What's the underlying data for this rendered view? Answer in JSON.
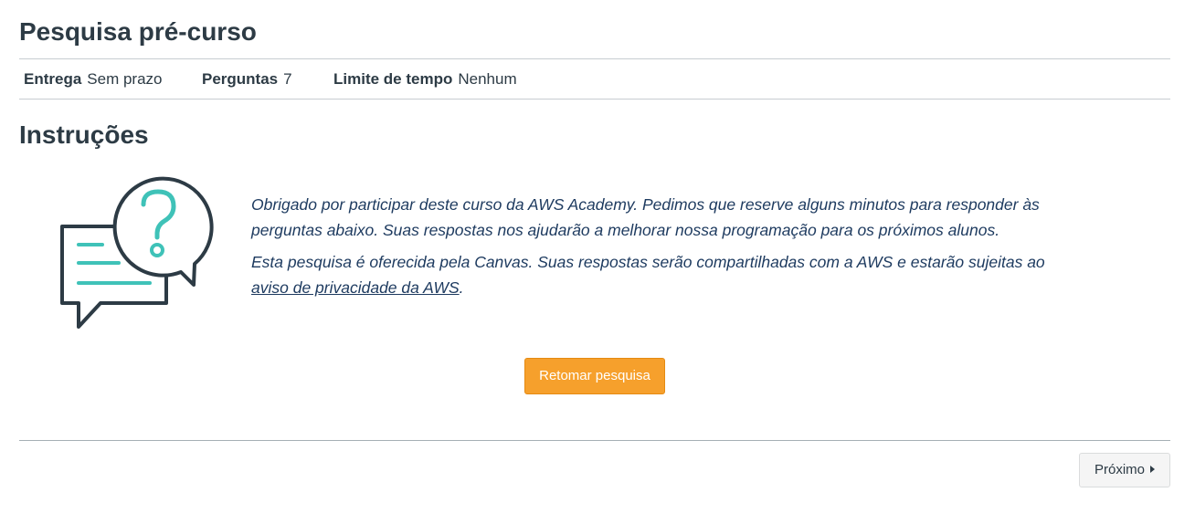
{
  "page": {
    "title": "Pesquisa pré-curso"
  },
  "meta": {
    "due_label": "Entrega",
    "due_value": "Sem prazo",
    "questions_label": "Perguntas",
    "questions_value": "7",
    "time_limit_label": "Limite de tempo",
    "time_limit_value": "Nenhum"
  },
  "instructions": {
    "heading": "Instruções",
    "paragraph1": "Obrigado por participar deste curso da AWS Academy. Pedimos que reserve alguns minutos para responder às perguntas abaixo. Suas respostas nos ajudarão a melhorar nossa programação para os próximos alunos.",
    "paragraph2_prefix": "Esta pesquisa é oferecida pela Canvas. Suas respostas serão compartilhadas com a AWS e estarão sujeitas ao ",
    "privacy_link": "aviso de privacidade da AWS",
    "paragraph2_suffix": "."
  },
  "actions": {
    "resume_label": "Retomar pesquisa",
    "next_label": "Próximo"
  },
  "colors": {
    "accent_orange": "#f6a02c",
    "icon_teal": "#3fc2b8",
    "icon_dark": "#2d3b45"
  },
  "icons": {
    "illustration": "question-speech-bubbles-icon",
    "next": "caret-right-icon"
  }
}
